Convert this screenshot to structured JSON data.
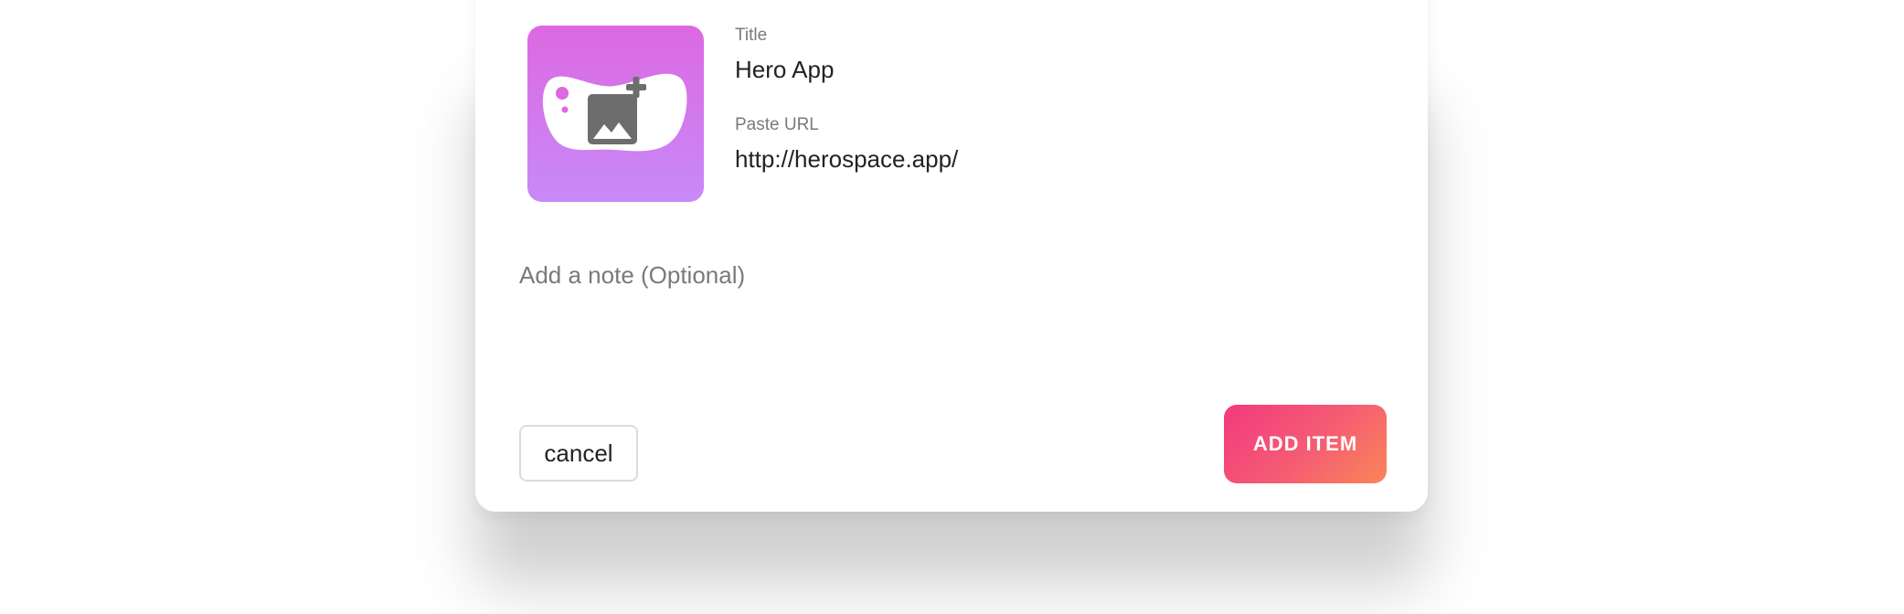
{
  "item": {
    "image": {
      "icon": "add-image-icon",
      "gradient_top": "#dd68e2",
      "gradient_bottom": "#c78af7"
    },
    "title_label": "Title",
    "title_value": "Hero App",
    "url_label": "Paste URL",
    "url_value": "http://herospace.app/"
  },
  "note": {
    "placeholder": "Add a note (Optional)",
    "value": ""
  },
  "actions": {
    "cancel_label": "cancel",
    "add_label": "ADD ITEM",
    "add_gradient": [
      "#f23a80",
      "#fa8558"
    ]
  }
}
